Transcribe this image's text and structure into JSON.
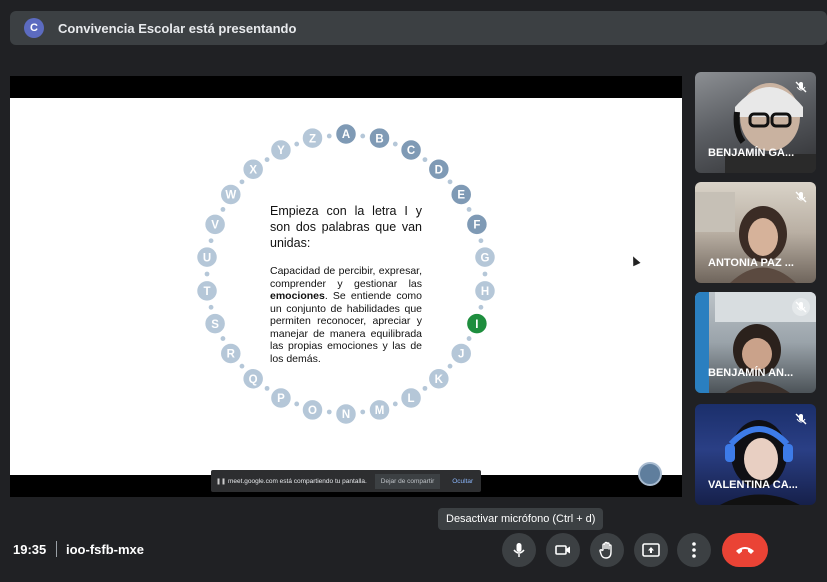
{
  "presenting": {
    "avatar_letter": "C",
    "text": "Convivencia Escolar está presentando"
  },
  "slide": {
    "letters": [
      "A",
      "B",
      "C",
      "D",
      "E",
      "F",
      "G",
      "H",
      "I",
      "J",
      "K",
      "L",
      "M",
      "N",
      "O",
      "P",
      "Q",
      "R",
      "S",
      "T",
      "U",
      "V",
      "W",
      "X",
      "Y",
      "Z"
    ],
    "active_letter": "I",
    "heading": "Empieza con la letra I y son dos palabras que van unidas:",
    "body_part1": "Capacidad de percibir, expresar, comprender y gestionar las ",
    "body_bold": "emociones",
    "body_part2": ". Se entiende como un conjunto de habilidades que permiten reconocer, apreciar y manejar de manera equilibrada las propias emociones y las de los demás."
  },
  "share_banner": {
    "text": "meet.google.com está compartiendo tu pantalla.",
    "stop_label": "Dejar de compartir",
    "hide_label": "Ocultar"
  },
  "participants": [
    {
      "name": "BENJAMÍN GA...",
      "muted": true
    },
    {
      "name": "ANTONIA PAZ ...",
      "muted": true
    },
    {
      "name": "BENJAMÍN AN...",
      "muted": true
    },
    {
      "name": "VALENTINA CA...",
      "muted": true
    }
  ],
  "tooltip": "Desactivar micrófono (Ctrl + d)",
  "footer": {
    "time": "19:35",
    "meeting_code": "ioo-fsfb-mxe"
  },
  "colors": {
    "letter_bubble": "#b5c7d8",
    "letter_bubble_dark": "#7f9ab5",
    "active_letter": "#1e8e3e",
    "end_call": "#ea4335"
  }
}
